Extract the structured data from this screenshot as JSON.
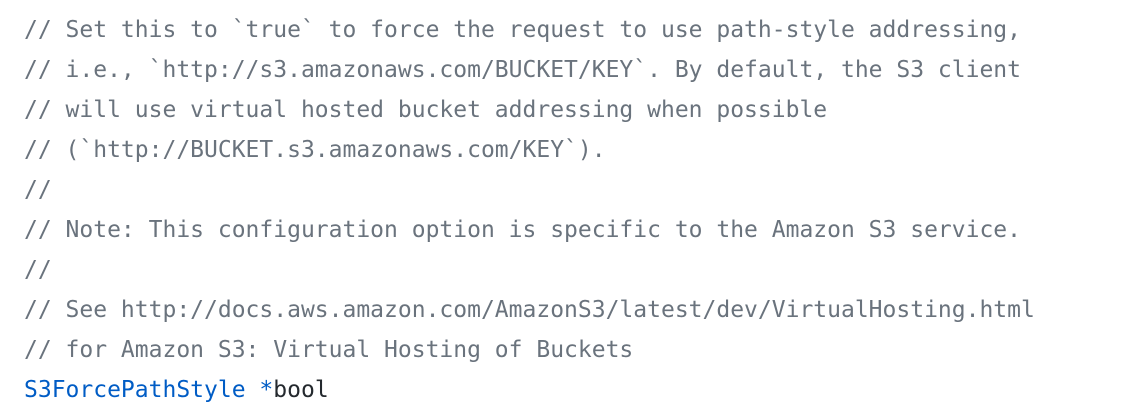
{
  "code": {
    "comment_lines": [
      "// Set this to `true` to force the request to use path-style addressing,",
      "// i.e., `http://s3.amazonaws.com/BUCKET/KEY`. By default, the S3 client",
      "// will use virtual hosted bucket addressing when possible",
      "// (`http://BUCKET.s3.amazonaws.com/KEY`).",
      "//",
      "// Note: This configuration option is specific to the Amazon S3 service.",
      "//",
      "// See http://docs.aws.amazon.com/AmazonS3/latest/dev/VirtualHosting.html",
      "// for Amazon S3: Virtual Hosting of Buckets"
    ],
    "declaration": {
      "field_name": "S3ForcePathStyle",
      "pointer": "*",
      "type_name": "bool"
    }
  },
  "colors": {
    "comment": "#6a737d",
    "field_name": "#005cc5",
    "text": "#24292e",
    "background": "#ffffff"
  }
}
